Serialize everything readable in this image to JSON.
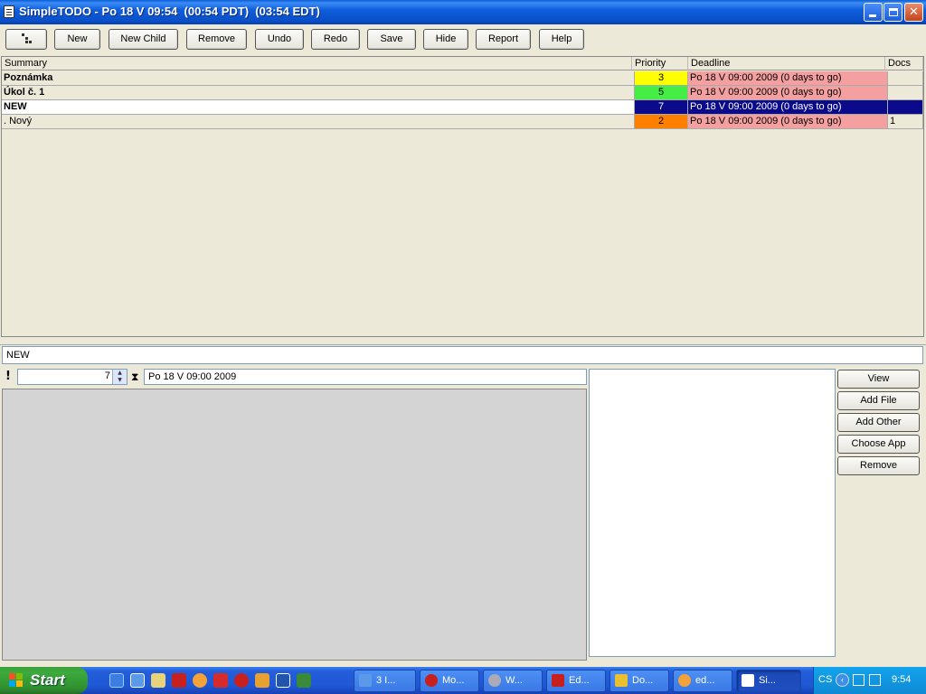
{
  "window": {
    "title": "SimpleTODO - Po 18 V 09:54  (00:54 PDT)  (03:54 EDT)"
  },
  "toolbar": {
    "buttons": [
      "New",
      "New Child",
      "Remove",
      "Undo",
      "Redo",
      "Save",
      "Hide",
      "Report",
      "Help"
    ]
  },
  "table": {
    "columns": [
      "Summary",
      "Priority",
      "Deadline",
      "Docs"
    ],
    "rows": [
      {
        "summary": "Poznámka",
        "priority": "3",
        "deadline": "Po 18 V 09:00 2009 (0 days to go)",
        "docs": "",
        "priority_color": "#ffff00",
        "deadline_color": "#f4a0a0"
      },
      {
        "summary": "Úkol č. 1",
        "priority": "5",
        "deadline": "Po 18 V 09:00 2009 (0 days to go)",
        "docs": "",
        "priority_color": "#44ee44",
        "deadline_color": "#f4a0a0"
      },
      {
        "summary": "NEW",
        "priority": "7",
        "deadline": "Po 18 V 09:00 2009 (0 days to go)",
        "docs": "",
        "priority_color": "#0a0a8a",
        "deadline_color": "#0a0a8a"
      },
      {
        "summary": ". Nový",
        "priority": "2",
        "deadline": "Po 18 V 09:00 2009 (0 days to go)",
        "docs": "1",
        "priority_color": "#ff8000",
        "deadline_color": "#f4a0a0"
      }
    ]
  },
  "detail": {
    "summary_value": "NEW",
    "priority_value": "7",
    "deadline_value": "Po 18 V 09:00 2009"
  },
  "side_buttons": [
    "View",
    "Add File",
    "Add Other",
    "Choose App",
    "Remove"
  ],
  "taskbar": {
    "start_label": "Start",
    "tasks": [
      "3 I...",
      "Mo...",
      "W...",
      "Ed...",
      "Do...",
      "ed...",
      "Si..."
    ],
    "language": "CS",
    "clock": "9:54"
  }
}
